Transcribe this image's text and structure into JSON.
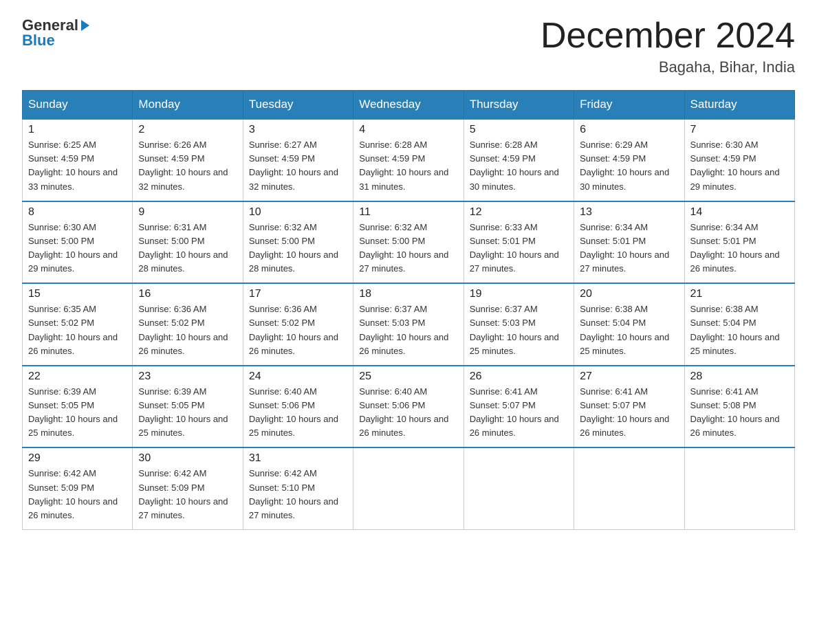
{
  "header": {
    "logo_general": "General",
    "logo_blue": "Blue",
    "month_title": "December 2024",
    "location": "Bagaha, Bihar, India"
  },
  "days_of_week": [
    "Sunday",
    "Monday",
    "Tuesday",
    "Wednesday",
    "Thursday",
    "Friday",
    "Saturday"
  ],
  "weeks": [
    [
      {
        "day": "1",
        "sunrise": "6:25 AM",
        "sunset": "4:59 PM",
        "daylight": "10 hours and 33 minutes."
      },
      {
        "day": "2",
        "sunrise": "6:26 AM",
        "sunset": "4:59 PM",
        "daylight": "10 hours and 32 minutes."
      },
      {
        "day": "3",
        "sunrise": "6:27 AM",
        "sunset": "4:59 PM",
        "daylight": "10 hours and 32 minutes."
      },
      {
        "day": "4",
        "sunrise": "6:28 AM",
        "sunset": "4:59 PM",
        "daylight": "10 hours and 31 minutes."
      },
      {
        "day": "5",
        "sunrise": "6:28 AM",
        "sunset": "4:59 PM",
        "daylight": "10 hours and 30 minutes."
      },
      {
        "day": "6",
        "sunrise": "6:29 AM",
        "sunset": "4:59 PM",
        "daylight": "10 hours and 30 minutes."
      },
      {
        "day": "7",
        "sunrise": "6:30 AM",
        "sunset": "4:59 PM",
        "daylight": "10 hours and 29 minutes."
      }
    ],
    [
      {
        "day": "8",
        "sunrise": "6:30 AM",
        "sunset": "5:00 PM",
        "daylight": "10 hours and 29 minutes."
      },
      {
        "day": "9",
        "sunrise": "6:31 AM",
        "sunset": "5:00 PM",
        "daylight": "10 hours and 28 minutes."
      },
      {
        "day": "10",
        "sunrise": "6:32 AM",
        "sunset": "5:00 PM",
        "daylight": "10 hours and 28 minutes."
      },
      {
        "day": "11",
        "sunrise": "6:32 AM",
        "sunset": "5:00 PM",
        "daylight": "10 hours and 27 minutes."
      },
      {
        "day": "12",
        "sunrise": "6:33 AM",
        "sunset": "5:01 PM",
        "daylight": "10 hours and 27 minutes."
      },
      {
        "day": "13",
        "sunrise": "6:34 AM",
        "sunset": "5:01 PM",
        "daylight": "10 hours and 27 minutes."
      },
      {
        "day": "14",
        "sunrise": "6:34 AM",
        "sunset": "5:01 PM",
        "daylight": "10 hours and 26 minutes."
      }
    ],
    [
      {
        "day": "15",
        "sunrise": "6:35 AM",
        "sunset": "5:02 PM",
        "daylight": "10 hours and 26 minutes."
      },
      {
        "day": "16",
        "sunrise": "6:36 AM",
        "sunset": "5:02 PM",
        "daylight": "10 hours and 26 minutes."
      },
      {
        "day": "17",
        "sunrise": "6:36 AM",
        "sunset": "5:02 PM",
        "daylight": "10 hours and 26 minutes."
      },
      {
        "day": "18",
        "sunrise": "6:37 AM",
        "sunset": "5:03 PM",
        "daylight": "10 hours and 26 minutes."
      },
      {
        "day": "19",
        "sunrise": "6:37 AM",
        "sunset": "5:03 PM",
        "daylight": "10 hours and 25 minutes."
      },
      {
        "day": "20",
        "sunrise": "6:38 AM",
        "sunset": "5:04 PM",
        "daylight": "10 hours and 25 minutes."
      },
      {
        "day": "21",
        "sunrise": "6:38 AM",
        "sunset": "5:04 PM",
        "daylight": "10 hours and 25 minutes."
      }
    ],
    [
      {
        "day": "22",
        "sunrise": "6:39 AM",
        "sunset": "5:05 PM",
        "daylight": "10 hours and 25 minutes."
      },
      {
        "day": "23",
        "sunrise": "6:39 AM",
        "sunset": "5:05 PM",
        "daylight": "10 hours and 25 minutes."
      },
      {
        "day": "24",
        "sunrise": "6:40 AM",
        "sunset": "5:06 PM",
        "daylight": "10 hours and 25 minutes."
      },
      {
        "day": "25",
        "sunrise": "6:40 AM",
        "sunset": "5:06 PM",
        "daylight": "10 hours and 26 minutes."
      },
      {
        "day": "26",
        "sunrise": "6:41 AM",
        "sunset": "5:07 PM",
        "daylight": "10 hours and 26 minutes."
      },
      {
        "day": "27",
        "sunrise": "6:41 AM",
        "sunset": "5:07 PM",
        "daylight": "10 hours and 26 minutes."
      },
      {
        "day": "28",
        "sunrise": "6:41 AM",
        "sunset": "5:08 PM",
        "daylight": "10 hours and 26 minutes."
      }
    ],
    [
      {
        "day": "29",
        "sunrise": "6:42 AM",
        "sunset": "5:09 PM",
        "daylight": "10 hours and 26 minutes."
      },
      {
        "day": "30",
        "sunrise": "6:42 AM",
        "sunset": "5:09 PM",
        "daylight": "10 hours and 27 minutes."
      },
      {
        "day": "31",
        "sunrise": "6:42 AM",
        "sunset": "5:10 PM",
        "daylight": "10 hours and 27 minutes."
      },
      null,
      null,
      null,
      null
    ]
  ],
  "labels": {
    "sunrise_prefix": "Sunrise: ",
    "sunset_prefix": "Sunset: ",
    "daylight_prefix": "Daylight: "
  }
}
